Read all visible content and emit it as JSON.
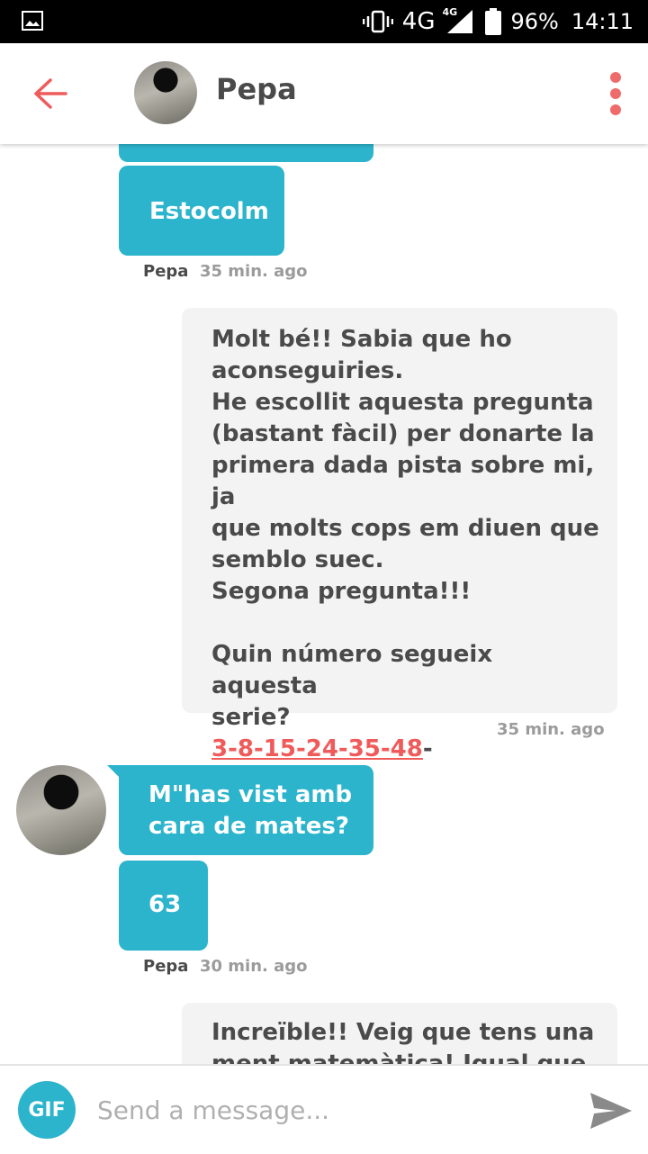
{
  "status_bar": {
    "network": "4G",
    "network_small": "4G",
    "battery": "96%",
    "time": "14:11"
  },
  "header": {
    "title": "Pepa"
  },
  "messages": {
    "m1": {
      "text": "Estocolm"
    },
    "meta1": {
      "sender": "Pepa",
      "time": "35 min. ago"
    },
    "m2": {
      "lines": [
        "Molt bé!! Sabia que ho",
        "aconseguiries.",
        "He escollit aquesta pregunta",
        "(bastant fàcil) per donarte la",
        "primera dada pista sobre mi, ja",
        "que molts cops em diuen que",
        "semblo suec.",
        "Segona pregunta!!!",
        "",
        "Quin número segueix aquesta",
        "serie?"
      ],
      "series_link": "3-8-15-24-35-48",
      "series_suffix": "-"
    },
    "meta2": {
      "time": "35 min. ago"
    },
    "m3": {
      "lines": [
        "M\"has vist amb",
        "cara de mates?"
      ]
    },
    "m4": {
      "text": "63"
    },
    "meta3": {
      "sender": "Pepa",
      "time": "30 min. ago"
    },
    "m5": {
      "lines": [
        "Increïble!! Veig que tens una",
        "ment matemàtica! Igual que"
      ]
    }
  },
  "composer": {
    "gif_label": "GIF",
    "placeholder": "Send a message..."
  },
  "colors": {
    "accent": "#2cb4cc",
    "link": "#ef5b5b",
    "outgoing_bg": "#f3f3f3"
  }
}
